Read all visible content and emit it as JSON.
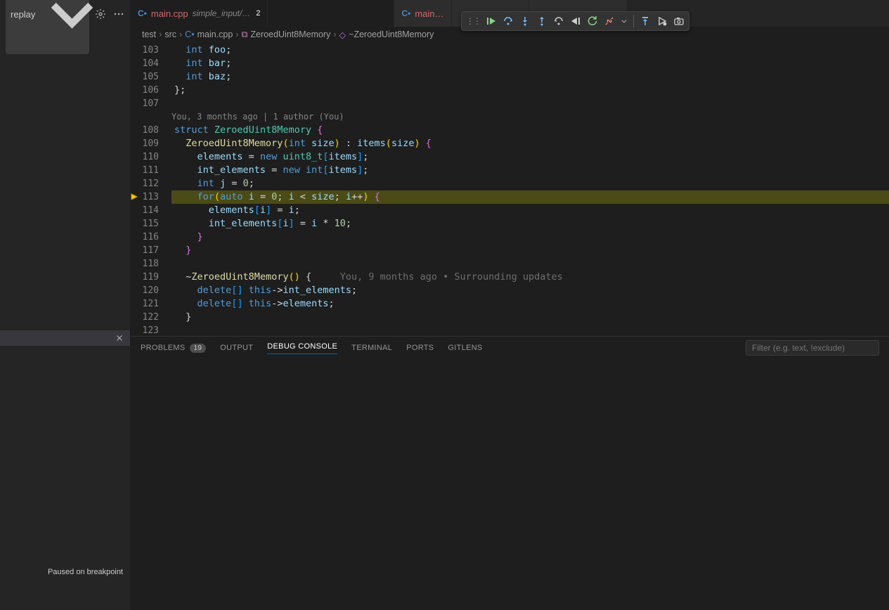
{
  "sidebar": {
    "select_label": "replay",
    "paused_status": "Paused on breakpoint"
  },
  "tabs": [
    {
      "icon": "C•",
      "name": "main.cpp",
      "detail": "simple_input/…",
      "badge": "2",
      "active": true
    },
    {
      "icon": "C•",
      "name": "main…",
      "detail": "",
      "badge": "",
      "active": false
    }
  ],
  "breadcrumb": [
    "test",
    "src",
    "main.cpp",
    "ZeroedUint8Memory",
    "~ZeroedUint8Memory"
  ],
  "lines": {
    "start": 103,
    "breakpoint_line": 113,
    "highlight_line": 113,
    "codelens": "You, 3 months ago | 1 author (You)",
    "inline_hint": "     You, 9 months ago • Surrounding updates"
  },
  "code": [
    {
      "n": 103,
      "tokens": [
        [
          "  ",
          "p"
        ],
        [
          "int",
          "kw"
        ],
        [
          " ",
          "p"
        ],
        [
          "foo",
          "var"
        ],
        [
          ";",
          "p"
        ]
      ]
    },
    {
      "n": 104,
      "tokens": [
        [
          "  ",
          "p"
        ],
        [
          "int",
          "kw"
        ],
        [
          " ",
          "p"
        ],
        [
          "bar",
          "var"
        ],
        [
          ";",
          "p"
        ]
      ]
    },
    {
      "n": 105,
      "tokens": [
        [
          "  ",
          "p"
        ],
        [
          "int",
          "kw"
        ],
        [
          " ",
          "p"
        ],
        [
          "baz",
          "var"
        ],
        [
          ";",
          "p"
        ]
      ]
    },
    {
      "n": 106,
      "tokens": [
        [
          "}",
          "p"
        ],
        [
          ";",
          "p"
        ]
      ]
    },
    {
      "n": 107,
      "tokens": [
        [
          "",
          "p"
        ]
      ]
    },
    {
      "lens": true
    },
    {
      "n": 108,
      "tokens": [
        [
          "struct",
          "kw"
        ],
        [
          " ",
          "p"
        ],
        [
          "ZeroedUint8Memory",
          "type"
        ],
        [
          " ",
          "p"
        ],
        [
          "{",
          "brace"
        ]
      ]
    },
    {
      "n": 109,
      "tokens": [
        [
          "  ",
          "p"
        ],
        [
          "ZeroedUint8Memory",
          "fn"
        ],
        [
          "(",
          "paren"
        ],
        [
          "int",
          "kw"
        ],
        [
          " ",
          "p"
        ],
        [
          "size",
          "var"
        ],
        [
          ")",
          "paren"
        ],
        [
          " : ",
          "p"
        ],
        [
          "items",
          "var"
        ],
        [
          "(",
          "paren"
        ],
        [
          "size",
          "var"
        ],
        [
          ")",
          "paren"
        ],
        [
          " ",
          "p"
        ],
        [
          "{",
          "brace"
        ]
      ]
    },
    {
      "n": 110,
      "tokens": [
        [
          "    ",
          "p"
        ],
        [
          "elements",
          "var"
        ],
        [
          " = ",
          "p"
        ],
        [
          "new",
          "kw"
        ],
        [
          " ",
          "p"
        ],
        [
          "uint8_t",
          "type"
        ],
        [
          "[",
          "brack"
        ],
        [
          "items",
          "var"
        ],
        [
          "]",
          "brack"
        ],
        [
          ";",
          "p"
        ]
      ]
    },
    {
      "n": 111,
      "tokens": [
        [
          "    ",
          "p"
        ],
        [
          "int_elements",
          "var"
        ],
        [
          " = ",
          "p"
        ],
        [
          "new",
          "kw"
        ],
        [
          " ",
          "p"
        ],
        [
          "int",
          "kw"
        ],
        [
          "[",
          "brack"
        ],
        [
          "items",
          "var"
        ],
        [
          "]",
          "brack"
        ],
        [
          ";",
          "p"
        ]
      ]
    },
    {
      "n": 112,
      "tokens": [
        [
          "    ",
          "p"
        ],
        [
          "int",
          "kw"
        ],
        [
          " ",
          "p"
        ],
        [
          "j",
          "var"
        ],
        [
          " = ",
          "p"
        ],
        [
          "0",
          "num"
        ],
        [
          ";",
          "p"
        ]
      ]
    },
    {
      "n": 113,
      "hl": true,
      "tokens": [
        [
          "    ",
          "p"
        ],
        [
          "for",
          "kw"
        ],
        [
          "(",
          "paren"
        ],
        [
          "auto",
          "kw"
        ],
        [
          " ",
          "p"
        ],
        [
          "i",
          "var"
        ],
        [
          " = ",
          "p"
        ],
        [
          "0",
          "num"
        ],
        [
          "; ",
          "p"
        ],
        [
          "i",
          "var"
        ],
        [
          " < ",
          "p"
        ],
        [
          "size",
          "var"
        ],
        [
          "; ",
          "p"
        ],
        [
          "i",
          "var"
        ],
        [
          "++",
          "p"
        ],
        [
          ")",
          "paren"
        ],
        [
          " ",
          "p"
        ],
        [
          "{",
          "brace"
        ]
      ]
    },
    {
      "n": 114,
      "tokens": [
        [
          "      ",
          "p"
        ],
        [
          "elements",
          "var"
        ],
        [
          "[",
          "brack"
        ],
        [
          "i",
          "var"
        ],
        [
          "]",
          "brack"
        ],
        [
          " = ",
          "p"
        ],
        [
          "i",
          "var"
        ],
        [
          ";",
          "p"
        ]
      ]
    },
    {
      "n": 115,
      "tokens": [
        [
          "      ",
          "p"
        ],
        [
          "int_elements",
          "var"
        ],
        [
          "[",
          "brack"
        ],
        [
          "i",
          "var"
        ],
        [
          "]",
          "brack"
        ],
        [
          " = ",
          "p"
        ],
        [
          "i",
          "var"
        ],
        [
          " * ",
          "p"
        ],
        [
          "10",
          "num"
        ],
        [
          ";",
          "p"
        ]
      ]
    },
    {
      "n": 116,
      "tokens": [
        [
          "    ",
          "p"
        ],
        [
          "}",
          "brace"
        ]
      ]
    },
    {
      "n": 117,
      "tokens": [
        [
          "  ",
          "p"
        ],
        [
          "}",
          "brace"
        ]
      ]
    },
    {
      "n": 118,
      "tokens": [
        [
          "",
          "p"
        ]
      ]
    },
    {
      "n": 119,
      "tokens": [
        [
          "  ",
          "p"
        ],
        [
          "~",
          "p"
        ],
        [
          "ZeroedUint8Memory",
          "fn"
        ],
        [
          "(",
          "paren"
        ],
        [
          ")",
          "paren"
        ],
        [
          " ",
          "p"
        ],
        [
          "{",
          "p"
        ]
      ],
      "hint": true
    },
    {
      "n": 120,
      "tokens": [
        [
          "    ",
          "p"
        ],
        [
          "delete",
          "kw"
        ],
        [
          "[",
          "brack"
        ],
        [
          "]",
          "brack"
        ],
        [
          " ",
          "p"
        ],
        [
          "this",
          "kw"
        ],
        [
          "->",
          "p"
        ],
        [
          "int_elements",
          "var"
        ],
        [
          ";",
          "p"
        ]
      ]
    },
    {
      "n": 121,
      "tokens": [
        [
          "    ",
          "p"
        ],
        [
          "delete",
          "kw"
        ],
        [
          "[",
          "brack"
        ],
        [
          "]",
          "brack"
        ],
        [
          " ",
          "p"
        ],
        [
          "this",
          "kw"
        ],
        [
          "->",
          "p"
        ],
        [
          "elements",
          "var"
        ],
        [
          ";",
          "p"
        ]
      ]
    },
    {
      "n": 122,
      "tokens": [
        [
          "  ",
          "p"
        ],
        [
          "}",
          "p"
        ]
      ]
    },
    {
      "n": 123,
      "tokens": [
        [
          "",
          "p"
        ]
      ]
    }
  ],
  "panel": {
    "tabs": [
      {
        "label": "PROBLEMS",
        "badge": "19"
      },
      {
        "label": "OUTPUT"
      },
      {
        "label": "DEBUG CONSOLE",
        "active": true
      },
      {
        "label": "TERMINAL"
      },
      {
        "label": "PORTS"
      },
      {
        "label": "GITLENS"
      }
    ],
    "filter_placeholder": "Filter (e.g. text, !exclude)"
  }
}
